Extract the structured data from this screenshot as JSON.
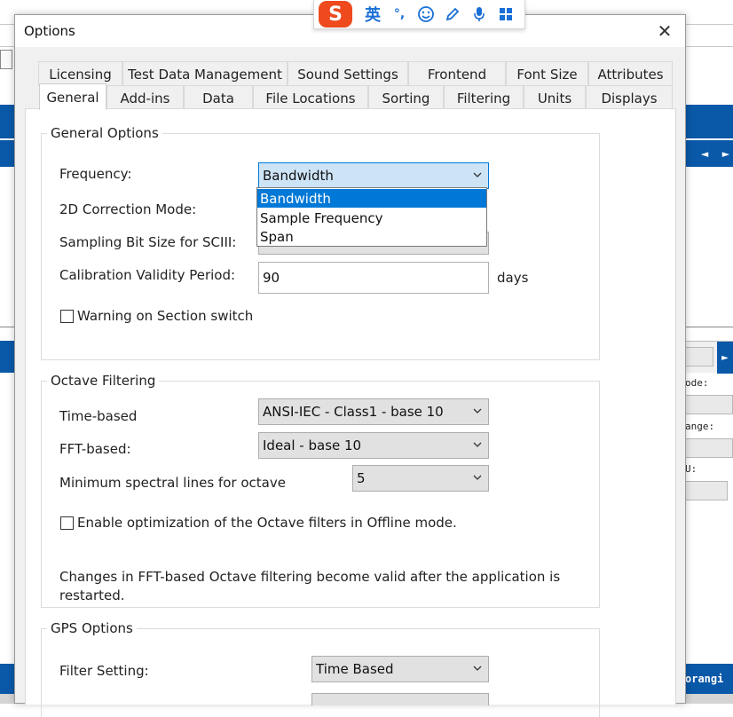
{
  "ime": {
    "logo": "S",
    "lang": "英",
    "punct": "°,",
    "icons": [
      "smiley-icon",
      "pen-icon",
      "microphone-icon",
      "grid-icon"
    ]
  },
  "background": {
    "labels": [
      "ode:",
      "ange:",
      "U:"
    ],
    "status_text": "orangi",
    "scroll_arrows": [
      "◄",
      "►"
    ]
  },
  "dialog": {
    "title": "Options",
    "close": "✕",
    "tabs_row1": [
      "Licensing",
      "Test Data Management",
      "Sound Settings",
      "Frontend",
      "Font Size",
      "Attributes"
    ],
    "tabs_row2": [
      "General",
      "Add-ins",
      "Data",
      "File Locations",
      "Sorting",
      "Filtering",
      "Units",
      "Displays"
    ],
    "active_tab": "General"
  },
  "general_options": {
    "title": "General Options",
    "frequency_label": "Frequency:",
    "frequency_value": "Bandwidth",
    "frequency_options": [
      "Bandwidth",
      "Sample Frequency",
      "Span"
    ],
    "correction_label": "2D Correction Mode:",
    "sampling_label": "Sampling Bit Size for SCIII:",
    "calibration_label": "Calibration Validity Period:",
    "calibration_value": "90",
    "calibration_unit": "days",
    "warning_label": "Warning on Section switch"
  },
  "octave_filtering": {
    "title": "Octave Filtering",
    "time_label": "Time-based",
    "time_value": "ANSI-IEC - Class1 - base 10",
    "fft_label": "FFT-based:",
    "fft_value": "Ideal - base 10",
    "min_lines_label": "Minimum spectral lines for octave",
    "min_lines_value": "5",
    "optimize_label": "Enable optimization of the Octave filters in Offline mode.",
    "note_line1": "Changes in FFT-based Octave filtering become valid after the application is",
    "note_line2": "restarted."
  },
  "gps_options": {
    "title": "GPS Options",
    "filter_label": "Filter Setting:",
    "filter_value": "Time Based"
  },
  "colors": {
    "accent": "#0078d7",
    "app_blue": "#0a58a8",
    "ime_orange": "#ee4a1e"
  }
}
